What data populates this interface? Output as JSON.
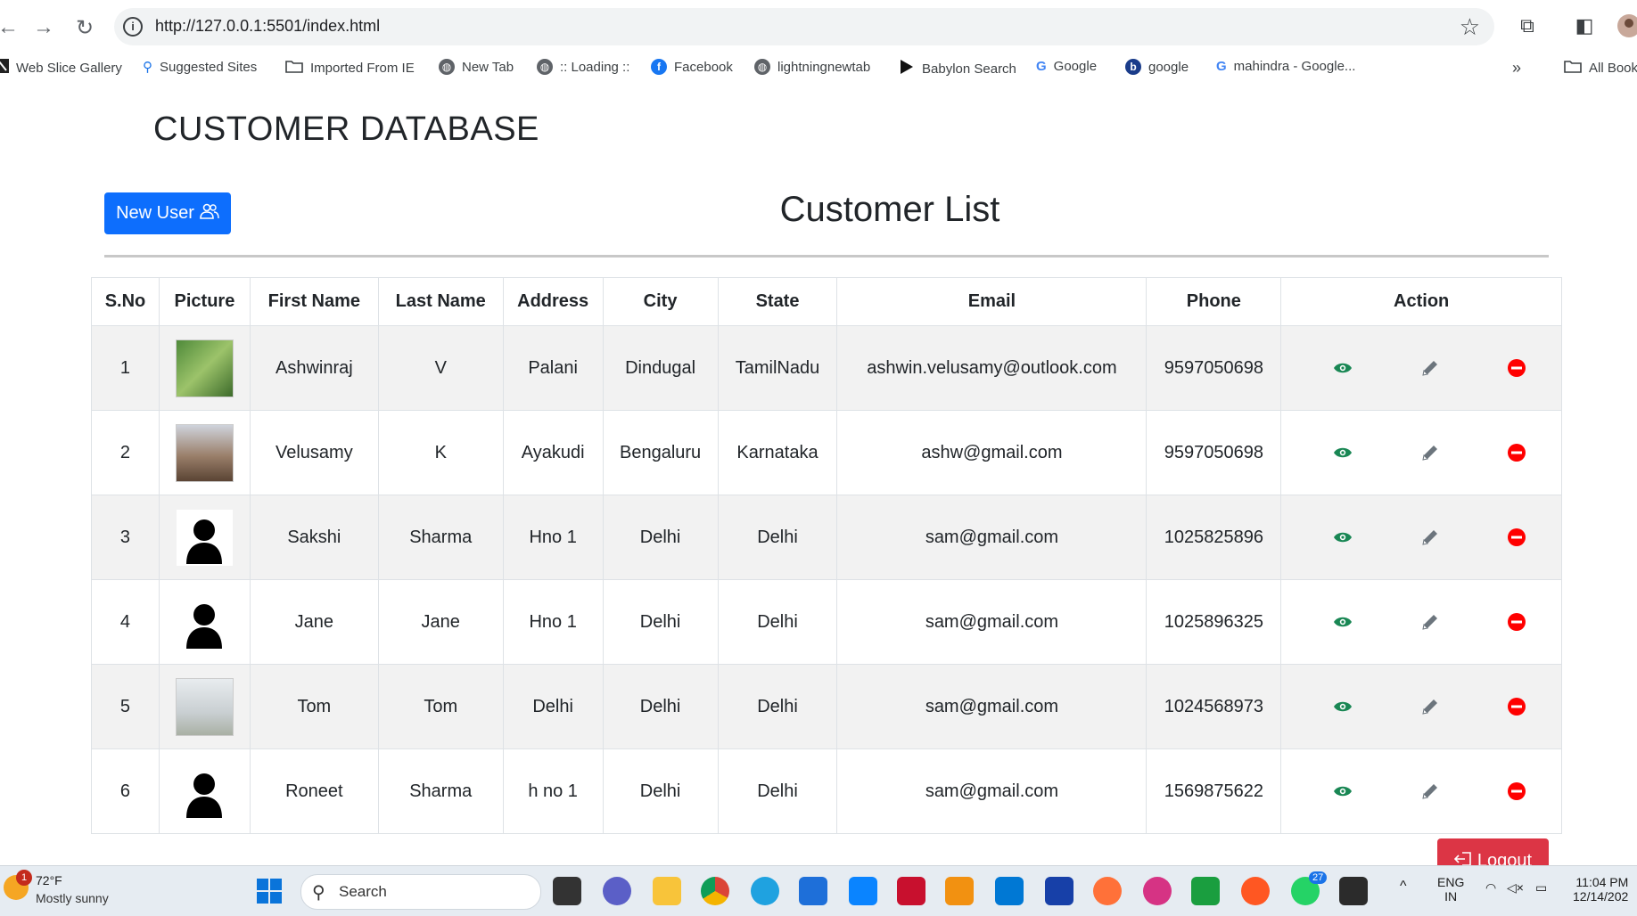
{
  "browser": {
    "url": "http://127.0.0.1:5501/index.html",
    "bookmarks": [
      {
        "label": "Web Slice Gallery",
        "icon": "web-slice-icon"
      },
      {
        "label": "Suggested Sites",
        "icon": "search-icon"
      },
      {
        "label": "Imported From IE",
        "icon": "folder-icon"
      },
      {
        "label": "New Tab",
        "icon": "globe-icon"
      },
      {
        "label": ":: Loading ::",
        "icon": "globe-icon"
      },
      {
        "label": "Facebook",
        "icon": "facebook-icon"
      },
      {
        "label": "lightningnewtab",
        "icon": "globe-icon"
      },
      {
        "label": "Babylon Search",
        "icon": "babylon-icon"
      },
      {
        "label": "Google",
        "icon": "google-icon"
      },
      {
        "label": "google",
        "icon": "babylon-b-icon"
      },
      {
        "label": "mahindra - Google...",
        "icon": "google-icon"
      },
      {
        "label": "All Book",
        "icon": "folder-icon"
      }
    ]
  },
  "page": {
    "title": "CUSTOMER DATABASE",
    "new_user_label": "New User",
    "list_title": "Customer List",
    "logout_label": "Logout"
  },
  "table": {
    "headers": [
      "S.No",
      "Picture",
      "First Name",
      "Last Name",
      "Address",
      "City",
      "State",
      "Email",
      "Phone",
      "Action"
    ],
    "rows": [
      {
        "sno": "1",
        "picture": "photo-green",
        "first": "Ashwinraj",
        "last": "V",
        "address": "Palani",
        "city": "Dindugal",
        "state": "TamilNadu",
        "email": "ashwin.velusamy@outlook.com",
        "phone": "9597050698"
      },
      {
        "sno": "2",
        "picture": "photo-brown",
        "first": "Velusamy",
        "last": "K",
        "address": "Ayakudi",
        "city": "Bengaluru",
        "state": "Karnataka",
        "email": "ashw@gmail.com",
        "phone": "9597050698"
      },
      {
        "sno": "3",
        "picture": "avatar",
        "first": "Sakshi",
        "last": "Sharma",
        "address": "Hno 1",
        "city": "Delhi",
        "state": "Delhi",
        "email": "sam@gmail.com",
        "phone": "1025825896"
      },
      {
        "sno": "4",
        "picture": "avatar",
        "first": "Jane",
        "last": "Jane",
        "address": "Hno 1",
        "city": "Delhi",
        "state": "Delhi",
        "email": "sam@gmail.com",
        "phone": "1025896325"
      },
      {
        "sno": "5",
        "picture": "photo-light",
        "first": "Tom",
        "last": "Tom",
        "address": "Delhi",
        "city": "Delhi",
        "state": "Delhi",
        "email": "sam@gmail.com",
        "phone": "1024568973"
      },
      {
        "sno": "6",
        "picture": "avatar",
        "first": "Roneet",
        "last": "Sharma",
        "address": "h no 1",
        "city": "Delhi",
        "state": "Delhi",
        "email": "sam@gmail.com",
        "phone": "1569875622"
      }
    ],
    "action_icons": [
      "view-eye-icon",
      "edit-pencil-icon",
      "delete-minus-icon"
    ],
    "colors": {
      "view": "#198754",
      "edit": "#6c757d",
      "delete": "#ff0000",
      "primary": "#0d6efd",
      "danger": "#dc3545",
      "stripe": "#f2f2f2"
    }
  },
  "taskbar": {
    "weather_temp": "72°F",
    "weather_cond": "Mostly sunny",
    "weather_badge": "1",
    "search_label": "Search",
    "whatsapp_badge": "27",
    "lang_top": "ENG",
    "lang_bottom": "IN",
    "time": "11:04 PM",
    "date": "12/14/202"
  }
}
